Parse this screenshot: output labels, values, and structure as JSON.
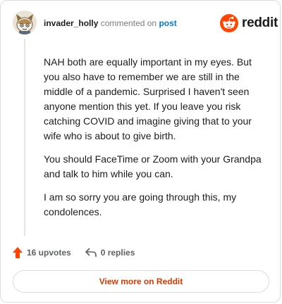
{
  "comment": {
    "author": "invader_holly",
    "action_text": "commented on",
    "post_link": "post",
    "paragraphs": [
      "NAH both are equally important in my eyes. But you also have to remember we are still in the middle of a pandemic. Surprised I haven't seen anyone mention this yet. If you leave you risk catching COVID and imagine giving that to your wife who is about to give birth.",
      "You should FaceTime or Zoom with your Grandpa and talk to him while you can.",
      "I am so sorry you are going through this, my condolences."
    ],
    "upvotes_label": "16 upvotes",
    "replies_label": "0 replies"
  },
  "brand": {
    "wordmark": "reddit",
    "icon": "reddit-snoo-icon",
    "color": "#ff4500"
  },
  "footer": {
    "view_more_label": "View more on Reddit",
    "accent_color": "#d93a00"
  },
  "icons": {
    "upvote": "upvote-arrow-icon",
    "reply": "reply-arrow-icon",
    "avatar": "user-avatar"
  }
}
